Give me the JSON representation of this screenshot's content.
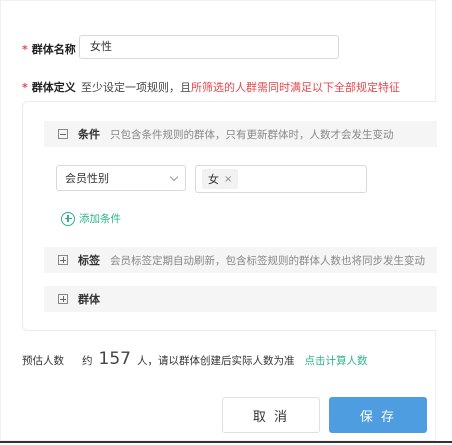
{
  "form": {
    "required_mark": "*",
    "name_label": "群体名称",
    "name_value": "女性",
    "definition_label": "群体定义",
    "definition_hint_prefix": "至少设定一项规则，且",
    "definition_hint_highlight": "所筛选的人群需同时满足以下全部规定特征"
  },
  "sections": {
    "conditions": {
      "title": "条件",
      "description": "只包含条件规则的群体，只有更新群体时，人数才会发生变动",
      "select_value": "会员性别",
      "tag_value": "女",
      "tag_remove": "×",
      "add_label": "添加条件"
    },
    "tags": {
      "title": "标签",
      "description": "会员标签定期自动刷新，包含标签规则的群体人数也将同步发生变动"
    },
    "groups": {
      "title": "群体"
    }
  },
  "estimate": {
    "label": "预估人数",
    "approx": "约",
    "count": "157",
    "note": "人，请以群体创建后实际人数为准",
    "calc_link": "点击计算人数"
  },
  "buttons": {
    "cancel": "取 消",
    "save": "保 存"
  },
  "colors": {
    "accent_green": "#2db48c",
    "primary_blue": "#4d9de0",
    "required_red": "#e5484d"
  },
  "icons": {
    "collapse": "minus-square-icon",
    "expand": "plus-square-icon",
    "dropdown": "chevron-down-icon",
    "add": "plus-circle-icon"
  }
}
